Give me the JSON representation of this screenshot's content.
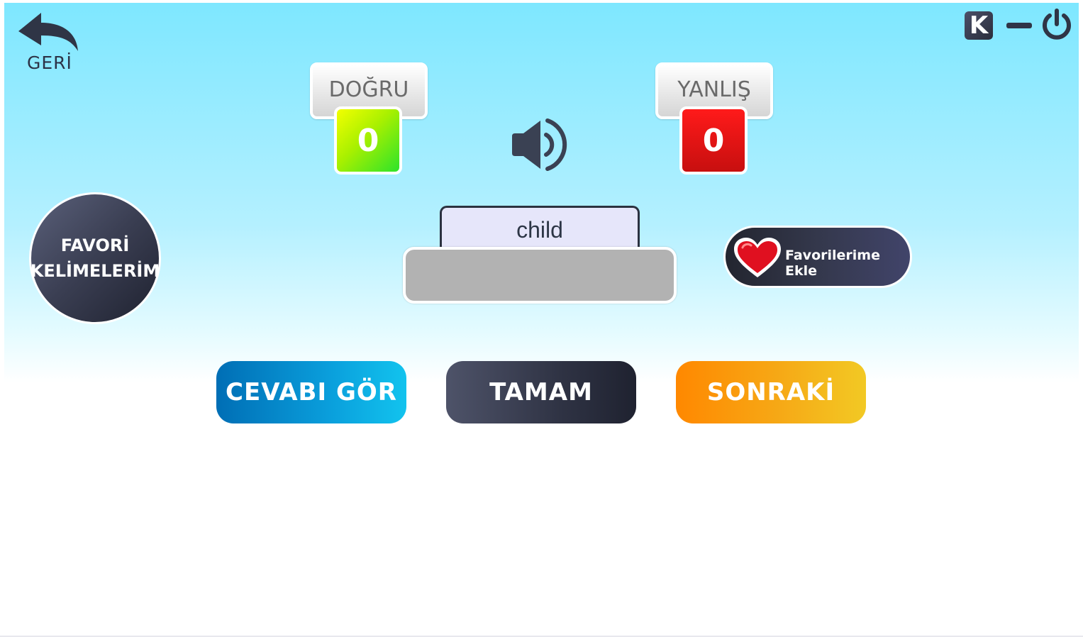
{
  "nav": {
    "back_label": "GERİ",
    "k_label": "K"
  },
  "score": {
    "correct_label": "DOĞRU",
    "correct_value": "0",
    "wrong_label": "YANLIŞ",
    "wrong_value": "0"
  },
  "favorites": {
    "circle_line1": "FAVORİ",
    "circle_line2": "KELİMELERİM",
    "add_label": "Favorilerime Ekle"
  },
  "word": {
    "text": "child",
    "answer_value": ""
  },
  "actions": {
    "show_answer": "CEVABI GÖR",
    "ok": "TAMAM",
    "next": "SONRAKİ"
  },
  "colors": {
    "correct": "#3ee02a",
    "wrong": "#d91414",
    "heart": "#e01020",
    "accent_blue": "#0a9fdc",
    "accent_orange": "#f6a916"
  },
  "icons": [
    "back-arrow-icon",
    "minimize-icon",
    "power-icon",
    "speaker-icon",
    "heart-icon"
  ]
}
